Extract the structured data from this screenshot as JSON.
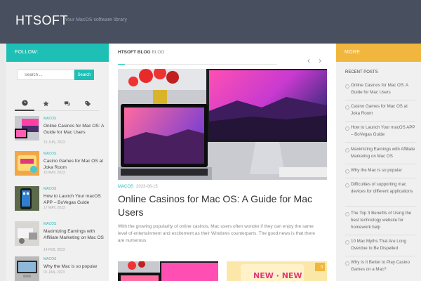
{
  "header": {
    "title": "HTSOFT",
    "tagline": "Your MacOS software library"
  },
  "left": {
    "heading": "FOLLOW:",
    "search": {
      "placeholder": "Search ...",
      "button": "Search"
    },
    "posts": [
      {
        "category": "MACOS",
        "title": "Online Casinos for Mac OS: A Guide for Mac Users",
        "date": "15 JUN, 2023"
      },
      {
        "category": "MACOS",
        "title": "Casino Games for Mac OS at Joka Room",
        "date": "16 MAY, 2023"
      },
      {
        "category": "MACOS",
        "title": "How to Launch Your macOS APP – BoVegas Guide",
        "date": "17 MAY, 2023"
      },
      {
        "category": "MACOS",
        "title": "Maximizing Earnings with Affiliate Marketing on Mac OS",
        "date": "14 FEB, 2023"
      },
      {
        "category": "MACOS",
        "title": "Why the Mac is so popular",
        "date": "01 JAN, 2023"
      }
    ]
  },
  "main": {
    "breadcrumb_bold": "HTSOFT BLOG",
    "breadcrumb_rest": "BLOG",
    "hero": {
      "category": "MACOS",
      "date": "2023-06-15",
      "title": "Online Casinos for Mac OS: A Guide for Mac Users",
      "excerpt": "With the growing popularity of online casinos, Mac users often wonder if they can enjoy the same level of entertainment and excitement as their Windows counterparts. The good news is that there are numerous"
    },
    "second_badge": "0"
  },
  "right": {
    "heading": "MORE",
    "recent_title": "RECENT POSTS",
    "items": [
      "Online Casinos for Mac OS: A Guide for Mac Users",
      "Casino Games for Mac OS at Joka Room",
      "How to Launch Your macOS APP – BoVegas Guide",
      "Maximizing Earnings with Affiliate Marketing on Mac OS",
      "Why the Mac is so popular",
      "Difficulties of supporting mac devices for different applications",
      "The Top 3 Benefits of Using the best technology website for homework help",
      "10 Mac Myths That Are Long Overdue to Be Dispelled",
      "Why Is It Better to Play Casino Games on a Mac?"
    ]
  },
  "colors": {
    "header": "#48505f",
    "accent": "#1ec0b6",
    "more": "#f0b63d"
  }
}
